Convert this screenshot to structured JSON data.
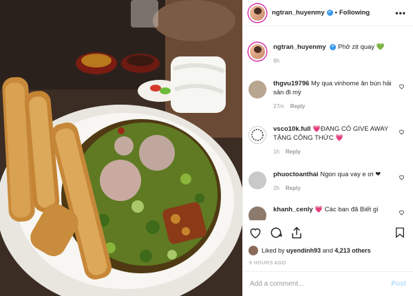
{
  "header": {
    "username": "ngtran_huyenmy",
    "follow_status": "Following",
    "separator": "•",
    "more": "•••",
    "verified_mark": "✔"
  },
  "caption": {
    "username": "ngtran_huyenmy",
    "text": "Phở zịt quay 💚",
    "time": "9h"
  },
  "comments": [
    {
      "username": "thgvu19796",
      "text": "My qua vinhome ăn bún hải sản đi mỳ",
      "time": "27m",
      "reply": "Reply",
      "avatar_color": "#b9a690"
    },
    {
      "username": "vsco10k.full",
      "text": "💗ĐANG CÓ GIVE AWAY TẶNG CÔNG THỨC 💗",
      "time": "1h",
      "reply": "Reply",
      "avatar_color": "#ffffff"
    },
    {
      "username": "phuoctoanthai",
      "text": "Ngon qua vay e ơi ❤",
      "time": "2h",
      "reply": "Reply",
      "avatar_color": "#c9c9c9"
    },
    {
      "username": "khanh_cenly",
      "text": "💗 Các ban đã Biết gì",
      "time": "",
      "reply": "",
      "avatar_color": "#8c7a6c"
    }
  ],
  "likes": {
    "prefix": "Liked by",
    "user": "uyendinh93",
    "conjunction": "and",
    "others": "4,213 others"
  },
  "timestamp": "9 HOURS AGO",
  "add_comment": {
    "placeholder": "Add a comment...",
    "post_label": "Post"
  },
  "icons": [
    "heart-icon",
    "comment-icon",
    "share-icon",
    "bookmark-icon",
    "more-icon",
    "verified-icon"
  ],
  "colors": {
    "accent": "#3897f0",
    "post_disabled": "#b2dffc",
    "meta": "#999999"
  }
}
